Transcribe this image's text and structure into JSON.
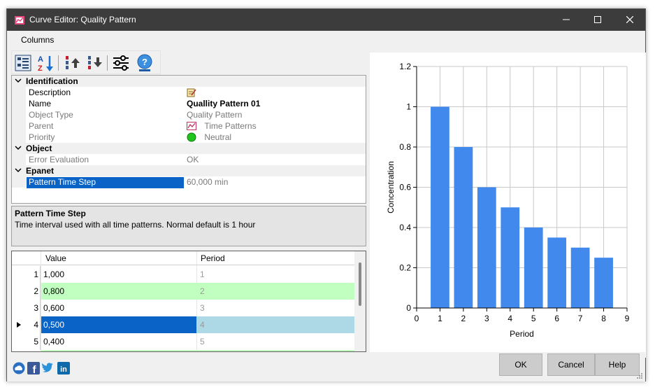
{
  "window": {
    "title": "Curve Editor: Quality Pattern",
    "menu": [
      "Columns"
    ]
  },
  "toolbar": {
    "icons": [
      "categorized-icon",
      "sort-alpha-icon",
      "move-up-icon",
      "move-down-icon",
      "settings-sliders-icon",
      "help-icon"
    ]
  },
  "properties": {
    "categories": [
      "Identification",
      "Object",
      "Epanet"
    ],
    "rows": [
      {
        "name": "Description",
        "value": "",
        "readonly": false
      },
      {
        "name": "Name",
        "value": "Quallity Pattern 01",
        "readonly": false
      },
      {
        "name": "Object Type",
        "value": "Quality Pattern",
        "readonly": true
      },
      {
        "name": "Parent",
        "value": "Time Patterns",
        "readonly": true
      },
      {
        "name": "Priority",
        "value": "Neutral",
        "readonly": true
      },
      {
        "name": "Error Evaluation",
        "value": "OK",
        "readonly": true
      },
      {
        "name": "Pattern Time Step",
        "value": "60,000 min",
        "readonly": true
      }
    ]
  },
  "description": {
    "title": "Pattern Time Step",
    "text": "Time interval used with all time patterns. Normal default is 1 hour"
  },
  "table": {
    "columns": [
      "Value",
      "Period"
    ],
    "rows": [
      {
        "num": "1",
        "value": "1,000",
        "period": "1"
      },
      {
        "num": "2",
        "value": "0,800",
        "period": "2"
      },
      {
        "num": "3",
        "value": "0,600",
        "period": "3"
      },
      {
        "num": "4",
        "value": "0,500",
        "period": "4"
      },
      {
        "num": "5",
        "value": "0,400",
        "period": "5"
      }
    ],
    "selected_row": 4,
    "colors": {
      "alt": "#c0ffc0",
      "selected": "#0a64c8",
      "selected_period": "#add8e6"
    }
  },
  "chart_data": {
    "type": "bar",
    "x": [
      1,
      2,
      3,
      4,
      5,
      6,
      7,
      8
    ],
    "values": [
      1.0,
      0.8,
      0.6,
      0.5,
      0.4,
      0.35,
      0.3,
      0.25
    ],
    "xlabel": "Period",
    "ylabel": "Concentration",
    "xlim": [
      0,
      9
    ],
    "ylim": [
      0,
      1.2
    ],
    "xticks": [
      "0",
      "1",
      "2",
      "3",
      "4",
      "5",
      "6",
      "7",
      "8",
      "9"
    ],
    "yticks": [
      "0",
      "0.2",
      "0.4",
      "0.6",
      "0.8",
      "1",
      "1.2"
    ],
    "grid": true,
    "bar_color": "#4189ec"
  },
  "buttons": {
    "ok": "OK",
    "cancel": "Cancel",
    "help": "Help"
  },
  "social": [
    "cloud-icon",
    "facebook-icon",
    "twitter-icon",
    "linkedin-icon"
  ]
}
